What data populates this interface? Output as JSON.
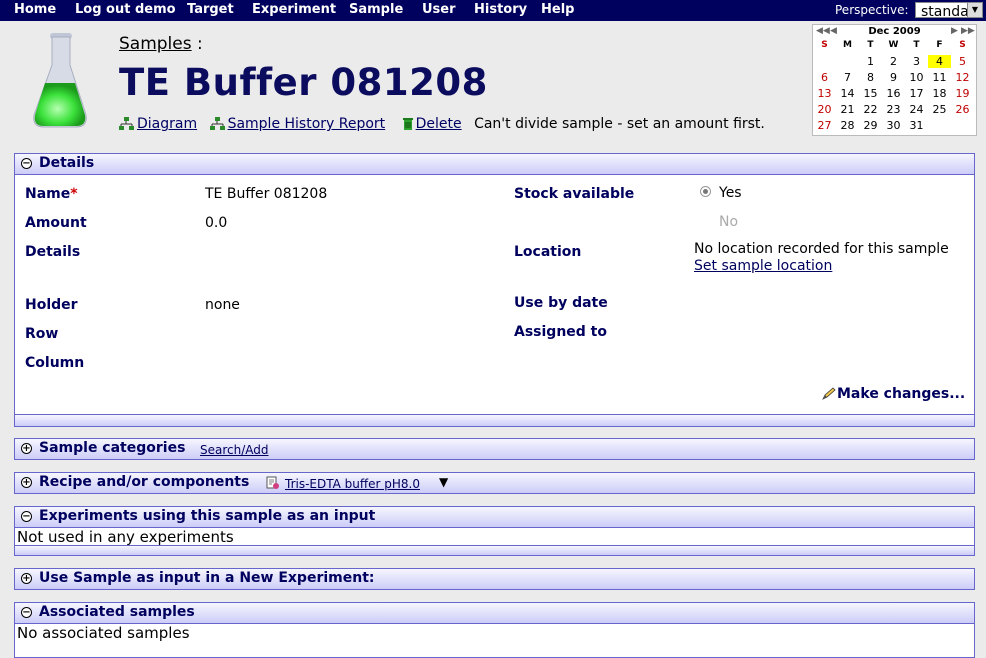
{
  "nav": {
    "items": [
      "Home",
      "Log out demo",
      "Target",
      "Experiment",
      "Sample",
      "User",
      "History",
      "Help"
    ],
    "perspective_label": "Perspective:",
    "perspective_value": "standard"
  },
  "header": {
    "breadcrumb_link": "Samples",
    "breadcrumb_sep": " :",
    "title": "TE Buffer 081208",
    "actions": {
      "diagram": "Diagram",
      "history_report": "Sample History Report",
      "delete": "Delete",
      "message": "Can't divide sample - set an amount first."
    }
  },
  "calendar": {
    "month": "Dec 2009",
    "weekdays": [
      "S",
      "M",
      "T",
      "W",
      "T",
      "F",
      "S"
    ],
    "weeks": [
      [
        "",
        "",
        "1",
        "2",
        "3",
        "4",
        "5"
      ],
      [
        "6",
        "7",
        "8",
        "9",
        "10",
        "11",
        "12"
      ],
      [
        "13",
        "14",
        "15",
        "16",
        "17",
        "18",
        "19"
      ],
      [
        "20",
        "21",
        "22",
        "23",
        "24",
        "25",
        "26"
      ],
      [
        "27",
        "28",
        "29",
        "30",
        "31",
        "",
        ""
      ]
    ],
    "today": "4",
    "colors": {
      "weekend": "#c00000",
      "today": "#ffff00"
    }
  },
  "details": {
    "title": "Details",
    "name_label": "Name",
    "name_required": "*",
    "name_value": "TE Buffer 081208",
    "amount_label": "Amount",
    "amount_value": "0.0",
    "details_label": "Details",
    "holder_label": "Holder",
    "holder_value": "none",
    "row_label": "Row",
    "column_label": "Column",
    "stock_label": "Stock available",
    "stock_yes": "Yes",
    "stock_no": "No",
    "location_label": "Location",
    "location_value": "No location recorded for this sample",
    "location_link": "Set sample location",
    "use_by_label": "Use by date",
    "assigned_label": "Assigned to",
    "make_changes": "Make changes..."
  },
  "categories": {
    "title": "Sample categories",
    "link": "Search/Add"
  },
  "recipe": {
    "title": "Recipe and/or components",
    "link": "Tris-EDTA buffer pH8.0",
    "arrow": "▼"
  },
  "experiments": {
    "title": "Experiments using this sample as an input",
    "text": "Not used in any experiments"
  },
  "new_experiment": {
    "title": "Use Sample as input in a New Experiment:"
  },
  "associated": {
    "title": "Associated samples",
    "text": "No associated samples"
  },
  "theme": {
    "nav_bg": "#00005e",
    "panel_border": "#6666cc",
    "title_color": "#0c0c5f"
  }
}
